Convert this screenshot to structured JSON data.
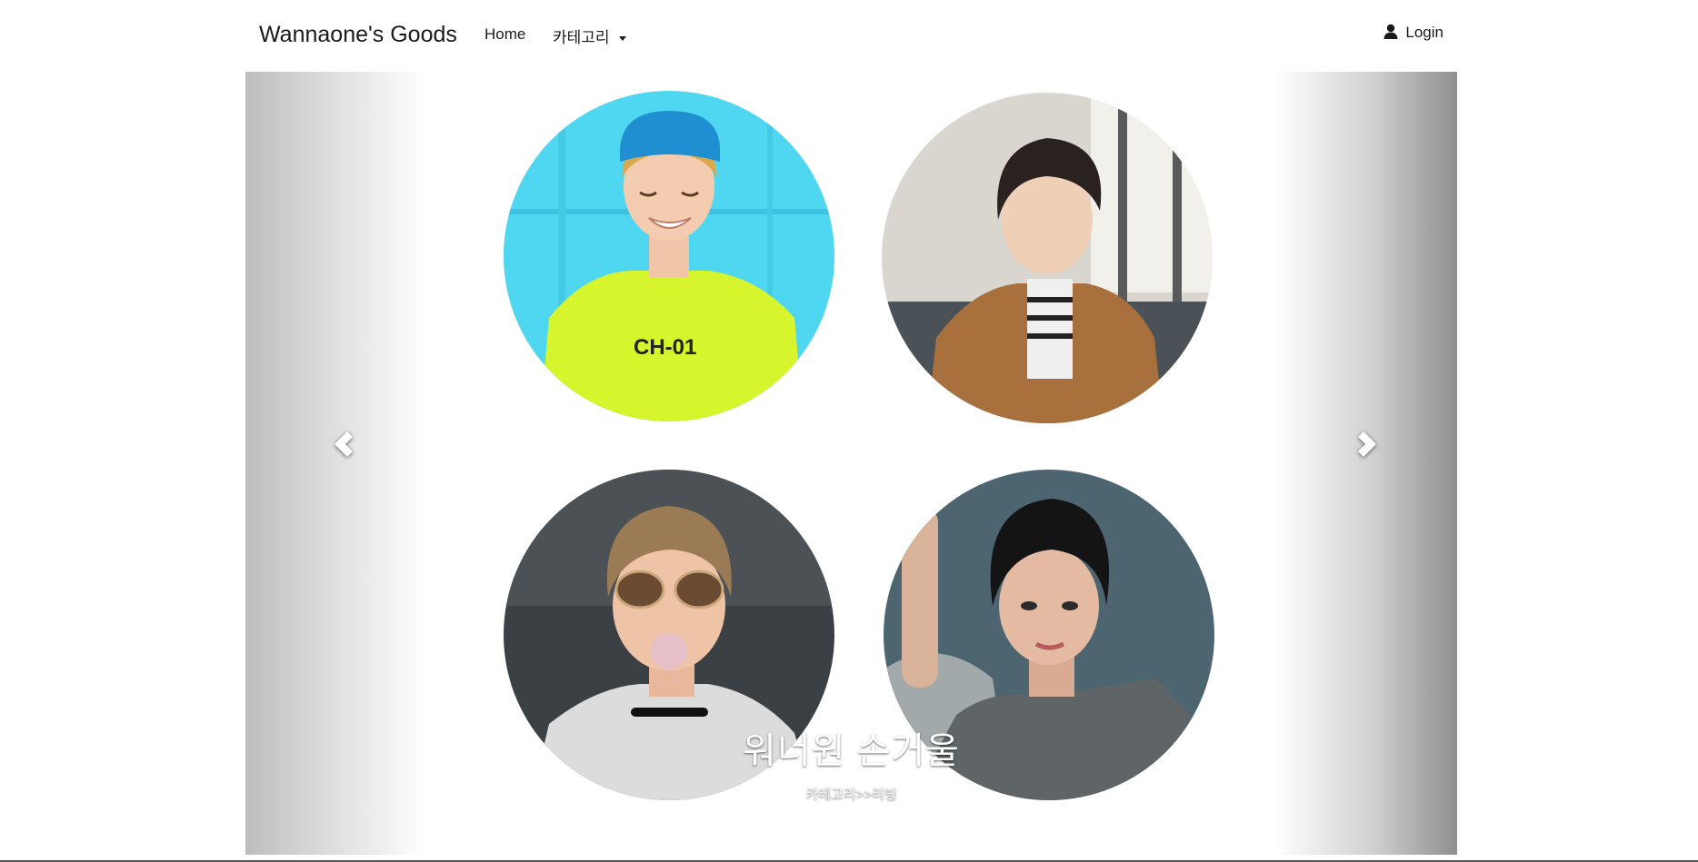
{
  "navbar": {
    "brand": "Wannaone's Goods",
    "home_label": "Home",
    "category_label": "카테고리",
    "login_label": "Login"
  },
  "carousel": {
    "caption_title": "워너원 손거울",
    "caption_subtitle": "카테고리>>리빙",
    "prev_icon": "chevron-left-icon",
    "next_icon": "chevron-right-icon",
    "photos": [
      {
        "shirt_text": "CH-01"
      },
      {},
      {},
      {}
    ]
  },
  "colors": {
    "photo1_bg": "#4fd6f0",
    "photo1_shirt": "#d7f52c",
    "photo1_cap": "#1f8fd1",
    "photo2_bg": "#d9d6cf",
    "photo2_jacket": "#a8703c",
    "photo3_bg": "#3a4044",
    "photo4_bg": "#4c6570",
    "photo4_sweater": "#5f6466"
  }
}
